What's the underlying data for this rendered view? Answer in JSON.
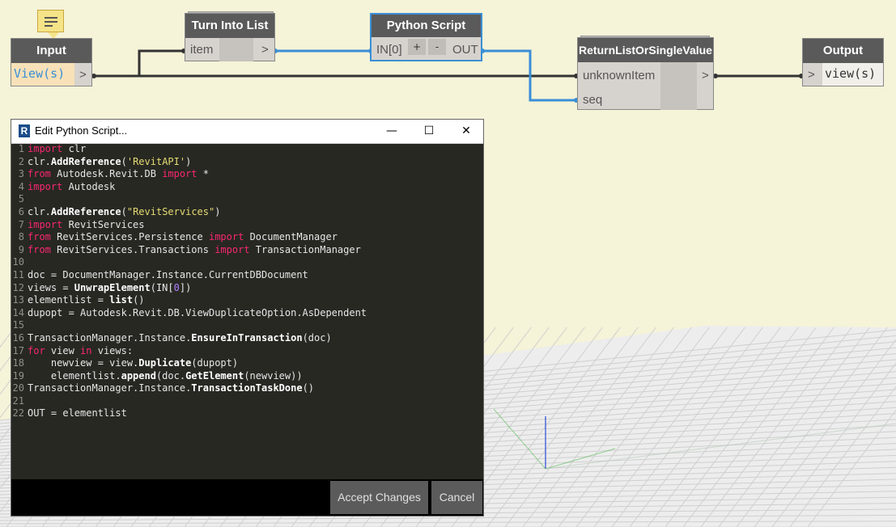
{
  "nodes": {
    "input": {
      "title": "Input",
      "value": "View(s)",
      "port": ">"
    },
    "turn_into_list": {
      "title": "Turn Into List",
      "input_port": "item",
      "output_port": ">"
    },
    "python_script": {
      "title": "Python Script",
      "input_port": "IN[0]",
      "add_label": "+",
      "remove_label": "-",
      "output_port": "OUT"
    },
    "return_list": {
      "title": "ReturnListOrSingleValue",
      "input_1": "unknownItem",
      "input_2": "seq",
      "output_port": ">"
    },
    "output": {
      "title": "Output",
      "port": ">",
      "value": "view(s)"
    }
  },
  "editor": {
    "title": "Edit Python Script...",
    "app_icon": "R",
    "minimize": "—",
    "maximize": "☐",
    "close": "✕",
    "code_lines": [
      "import clr",
      "clr.AddReference('RevitAPI')",
      "from Autodesk.Revit.DB import *",
      "import Autodesk",
      "",
      "clr.AddReference(\"RevitServices\")",
      "import RevitServices",
      "from RevitServices.Persistence import DocumentManager",
      "from RevitServices.Transactions import TransactionManager",
      "",
      "doc = DocumentManager.Instance.CurrentDBDocument",
      "views = UnwrapElement(IN[0])",
      "elementlist = list()",
      "dupopt = Autodesk.Revit.DB.ViewDuplicateOption.AsDependent",
      "",
      "TransactionManager.Instance.EnsureInTransaction(doc)",
      "for view in views:",
      "    newview = view.Duplicate(dupopt)",
      "    elementlist.append(doc.GetElement(newview))",
      "TransactionManager.Instance.TransactionTaskDone()",
      "",
      "OUT = elementlist"
    ],
    "accept_label": "Accept Changes",
    "cancel_label": "Cancel"
  },
  "colors": {
    "canvas_bg": "#f5f3d8",
    "wire": "#333333",
    "wire_selected": "#3a8fd6",
    "editor_bg": "#272822",
    "keyword": "#f92672",
    "string": "#e6db74"
  }
}
